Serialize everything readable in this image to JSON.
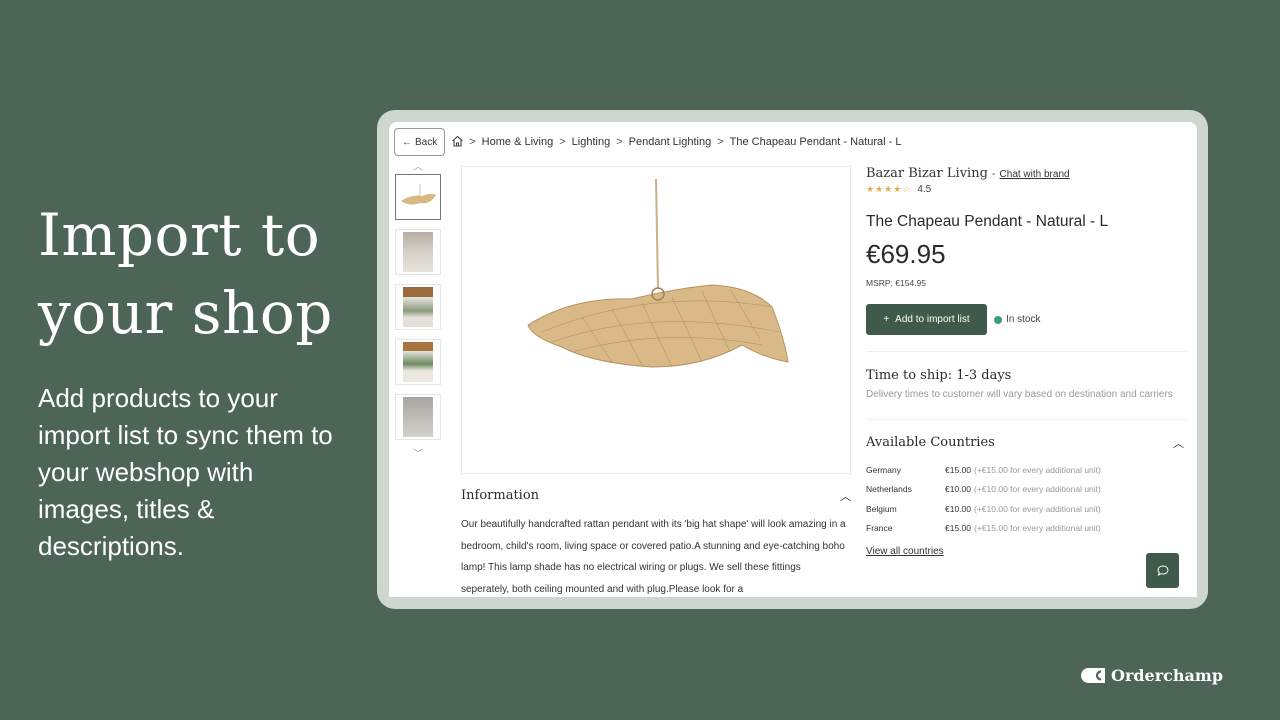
{
  "hero": {
    "title_line1": "Import to",
    "title_line2": "your shop",
    "subtitle": "Add products to your import list to sync them to your webshop with images, titles & descriptions."
  },
  "breadcrumb": {
    "back_label": "Back",
    "items": [
      "Home & Living",
      "Lighting",
      "Pendant Lighting",
      "The Chapeau Pendant - Natural - L"
    ],
    "separator": ">"
  },
  "gallery": {
    "thumbnail_count": 5,
    "active_index": 0
  },
  "product": {
    "brand": "Bazar Bizar Living",
    "brand_separator": "-",
    "chat_link": "Chat with brand",
    "rating": "4.5",
    "stars": "★★★★☆",
    "title": "The Chapeau Pendant - Natural - L",
    "price": "€69.95",
    "msrp": "MSRP: €154.95",
    "add_button": "Add to import list",
    "stock_status": "In stock",
    "stock_color": "#3d9a73"
  },
  "shipping": {
    "title": "Time to ship: 1-3 days",
    "note": "Delivery times to customer will vary based on destination and carriers"
  },
  "countries": {
    "title": "Available Countries",
    "rows": [
      {
        "name": "Germany",
        "price": "€15.00",
        "extra": "(+€15.00 for every additional unit)"
      },
      {
        "name": "Netherlands",
        "price": "€10.00",
        "extra": "(+€10.00 for every additional unit)"
      },
      {
        "name": "Belgium",
        "price": "€10.00",
        "extra": "(+€10.00 for every additional unit)"
      },
      {
        "name": "France",
        "price": "€15.00",
        "extra": "(+€15.00 for every additional unit)"
      }
    ],
    "view_all": "View all countries"
  },
  "information": {
    "title": "Information",
    "body": "Our beautifully handcrafted rattan pendant with its 'big hat shape' will look amazing in a bedroom, child's room, living space or covered patio.A stunning and eye-catching boho lamp! This lamp shade has no electrical wiring or plugs. We sell these fittings seperately, both ceiling mounted and with plug.Please look for a"
  },
  "brand_logo": {
    "text": "Orderchamp"
  },
  "colors": {
    "background": "#4d6556",
    "accent": "#3f5a4b",
    "star": "#e3ae4c"
  }
}
